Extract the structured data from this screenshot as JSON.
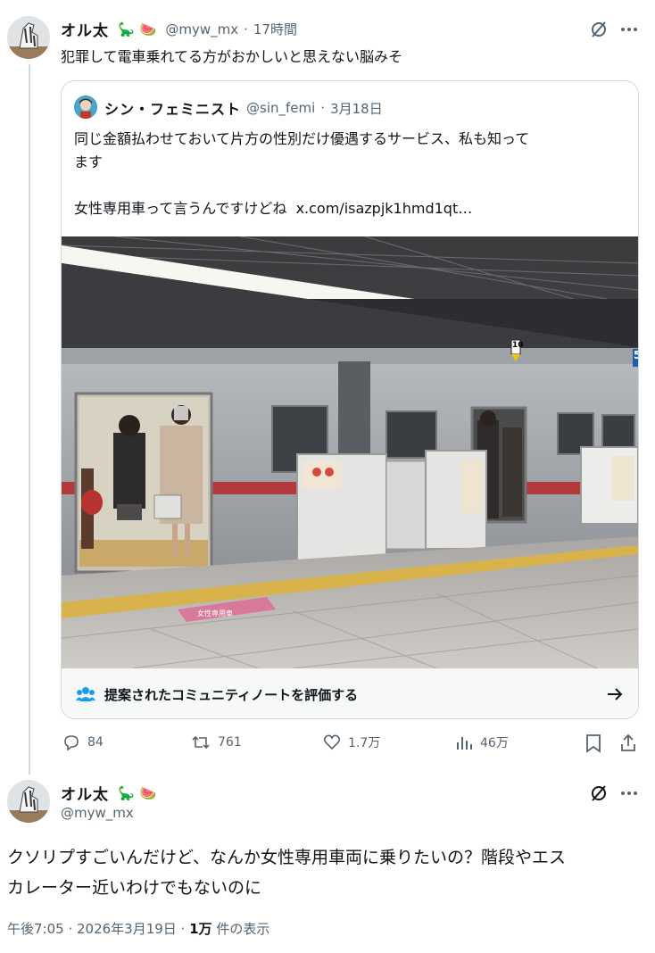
{
  "tweet1": {
    "display_name": "オル太",
    "emojis": [
      "🦕",
      "🍉"
    ],
    "handle": "@myw_mx",
    "dot": "·",
    "time": "17時間",
    "text": "犯罪して電車乗れてる方がおかしいと思えない脳みそ",
    "more_icon": "more-icon",
    "grok_icon": "grok-icon"
  },
  "quote": {
    "display_name": "シン・フェミニスト",
    "handle": "@sin_femi",
    "dot": "·",
    "date": "3月18日",
    "text_line1": "同じ金額払わせておいて片方の性別だけ優遇するサービス、私も知って",
    "text_line2": "ます",
    "text_line3": "女性専用車って言うんですけどね",
    "link": "x.com/isazpjk1hmd1qt…",
    "photo_alt": "subway-platform-photo",
    "platform_sign": "女性専用車",
    "track_number": "5",
    "car_marker": "10"
  },
  "community_note": {
    "label": "提案されたコミュニティノートを評価する",
    "icon": "people-icon",
    "arrow": "arrow-right-icon"
  },
  "actions": {
    "replies": "84",
    "retweets": "761",
    "likes": "1.7万",
    "views": "46万"
  },
  "tweet2": {
    "display_name": "オル太",
    "emojis": [
      "🦕",
      "🍉"
    ],
    "handle": "@myw_mx",
    "text_line1": "クソリプすごいんだけど、なんか女性専用車両に乗りたいの？階段やエス",
    "text_line2": "カレーター近いわけでもないのに",
    "timestamp": "午後7:05 · 2026年3月19日 · ",
    "views_count": "1万",
    "views_label": " 件の表示"
  },
  "colors": {
    "text": "#0f1419",
    "muted": "#536471",
    "border": "#cfd9de",
    "note_bg": "#f7f9f9"
  }
}
